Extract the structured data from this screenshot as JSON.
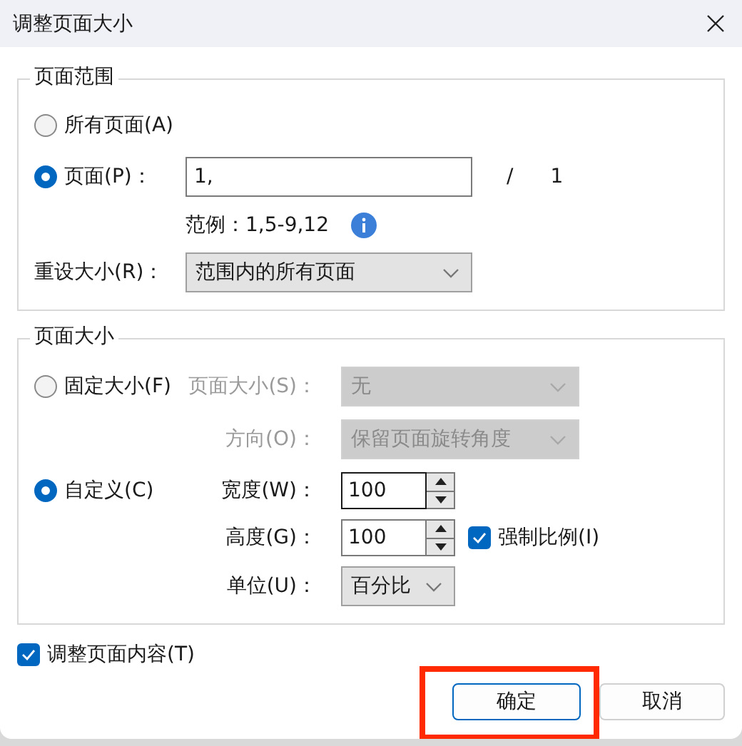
{
  "window": {
    "title": "调整页面大小"
  },
  "page_range": {
    "title": "页面范围",
    "options": [
      {
        "label": "所有页面(A)",
        "selected": false
      },
      {
        "label": "页面(P)：",
        "selected": true,
        "value": "1,",
        "separator": "/",
        "total": "1"
      }
    ],
    "example": "范例：1,5-9,12",
    "resize": {
      "label": "重设大小(R)：",
      "value": "范围内的所有页面"
    }
  },
  "page_size": {
    "title": "页面大小",
    "options": [
      {
        "label": "固定大小(F)",
        "selected": false
      },
      {
        "label": "自定义(C)",
        "selected": true
      }
    ],
    "size_select": {
      "label": "页面大小(S)：",
      "value": "无",
      "disabled": true
    },
    "orientation": {
      "label": "方向(O)：",
      "value": "保留页面旋转角度",
      "disabled": true
    },
    "width": {
      "label": "宽度(W)：",
      "value": "100"
    },
    "height": {
      "label": "高度(G)：",
      "value": "100"
    },
    "constrain": {
      "label": "强制比例(I)",
      "checked": true
    },
    "unit": {
      "label": "单位(U)：",
      "value": "百分比"
    }
  },
  "adjust_content": {
    "label": "调整页面内容(T)",
    "checked": true
  },
  "buttons": [
    {
      "label": "确定",
      "default": true,
      "annotated": true
    },
    {
      "label": "取消",
      "default": false,
      "annotated": false
    }
  ]
}
